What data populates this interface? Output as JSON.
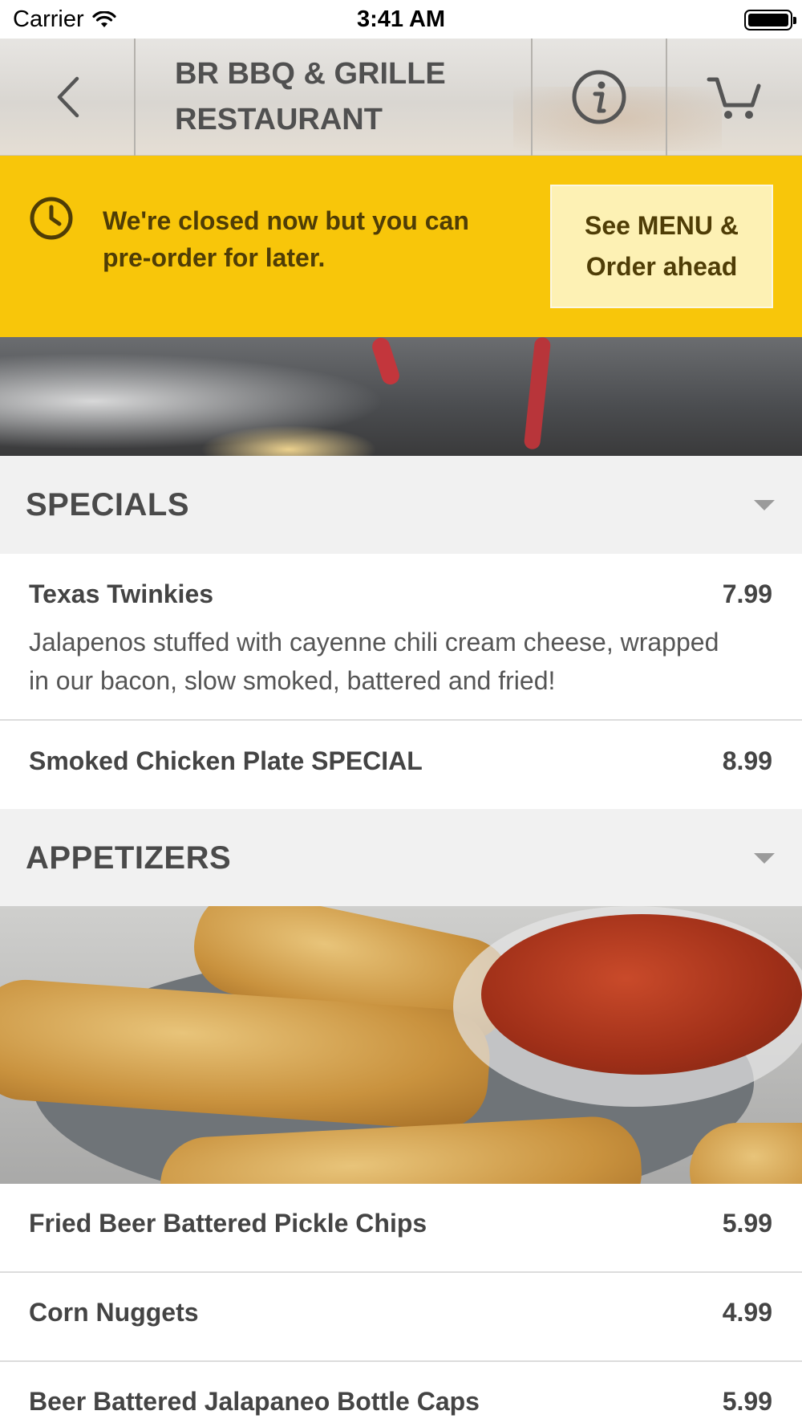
{
  "status_bar": {
    "carrier": "Carrier",
    "time": "3:41 AM"
  },
  "header": {
    "restaurant_name": "BR BBQ & GRILLE RESTAURANT",
    "icons": [
      "chevron-left-icon",
      "info-icon",
      "cart-icon"
    ]
  },
  "closed_banner": {
    "message": "We're closed now but you can pre-order for later.",
    "button_label": "See MENU & Order ahead",
    "icon": "clock-icon",
    "color": "#f8c60a"
  },
  "sections": [
    {
      "title": "SPECIALS",
      "items": [
        {
          "name": "Texas Twinkies",
          "price": "7.99",
          "description": "Jalapenos stuffed with cayenne chili cream cheese, wrapped in our bacon, slow smoked, battered and fried!"
        },
        {
          "name": "Smoked Chicken Plate SPECIAL",
          "price": "8.99"
        }
      ]
    },
    {
      "title": "APPETIZERS",
      "items": [
        {
          "name": "Fried Beer Battered Pickle Chips",
          "price": "5.99"
        },
        {
          "name": "Corn Nuggets",
          "price": "4.99"
        },
        {
          "name": "Beer Battered Jalapaneo Bottle Caps",
          "price": "5.99"
        }
      ]
    }
  ]
}
